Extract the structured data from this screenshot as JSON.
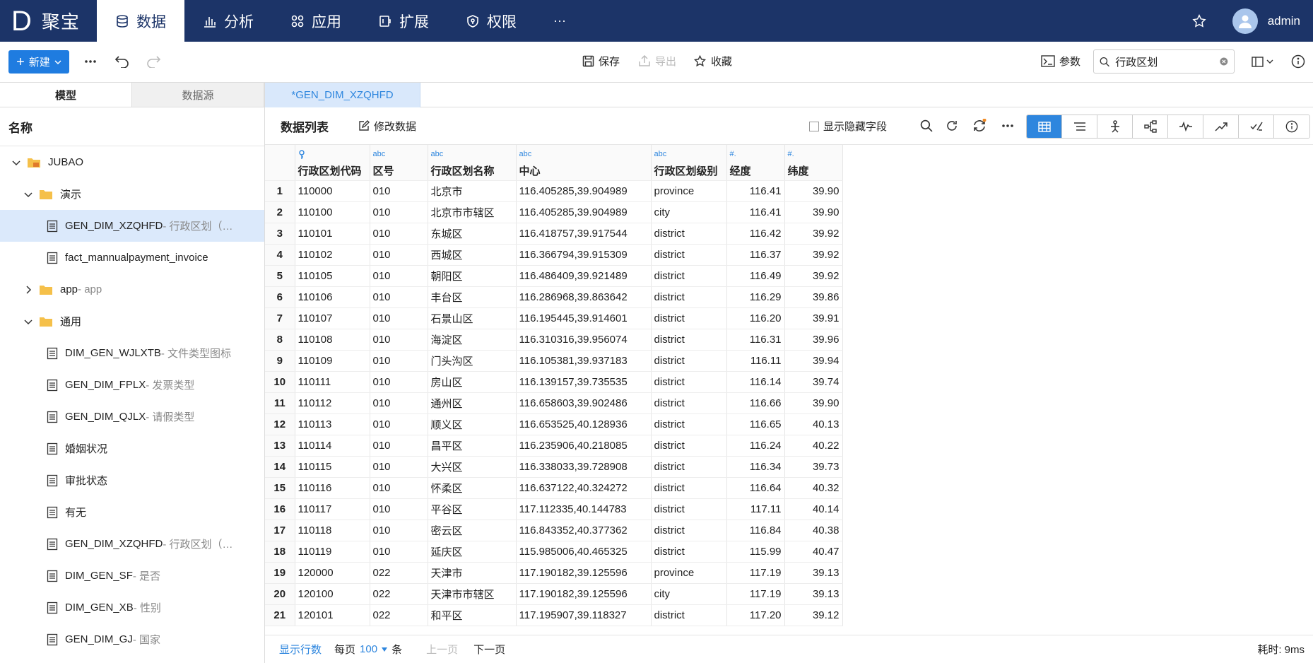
{
  "app": {
    "logo_letter": "D",
    "name": "聚宝",
    "user": "admin"
  },
  "nav": [
    {
      "label": "数据",
      "icon": "database-icon",
      "active": true
    },
    {
      "label": "分析",
      "icon": "bar-chart-icon"
    },
    {
      "label": "应用",
      "icon": "apps-icon"
    },
    {
      "label": "扩展",
      "icon": "extension-icon"
    },
    {
      "label": "权限",
      "icon": "shield-icon"
    }
  ],
  "nav_more": "···",
  "toolbar": {
    "new_label": "新建",
    "save_label": "保存",
    "export_label": "导出",
    "favorite_label": "收藏",
    "params_label": "参数",
    "search_value": "行政区划"
  },
  "left": {
    "tab_model": "模型",
    "tab_datasource": "数据源",
    "header": "名称",
    "tree": [
      {
        "level": 0,
        "type": "root",
        "label": "JUBAO",
        "suffix": "",
        "expanded": true
      },
      {
        "level": 1,
        "type": "folder",
        "label": "演示",
        "suffix": "",
        "expanded": true
      },
      {
        "level": 2,
        "type": "table",
        "label": "GEN_DIM_XZQHFD",
        "suffix": " - 行政区划（…",
        "selected": true
      },
      {
        "level": 2,
        "type": "table",
        "label": "fact_mannualpayment_invoice",
        "suffix": ""
      },
      {
        "level": 1,
        "type": "folder",
        "label": "app",
        "suffix": " - app",
        "expanded": false
      },
      {
        "level": 1,
        "type": "folder",
        "label": "通用",
        "suffix": "",
        "expanded": true
      },
      {
        "level": 2,
        "type": "table",
        "label": "DIM_GEN_WJLXTB",
        "suffix": " - 文件类型图标"
      },
      {
        "level": 2,
        "type": "table",
        "label": "GEN_DIM_FPLX",
        "suffix": " - 发票类型"
      },
      {
        "level": 2,
        "type": "table",
        "label": "GEN_DIM_QJLX",
        "suffix": " - 请假类型"
      },
      {
        "level": 2,
        "type": "table",
        "label": "婚姻状况",
        "suffix": ""
      },
      {
        "level": 2,
        "type": "table",
        "label": "审批状态",
        "suffix": ""
      },
      {
        "level": 2,
        "type": "table",
        "label": "有无",
        "suffix": ""
      },
      {
        "level": 2,
        "type": "table",
        "label": "GEN_DIM_XZQHFD",
        "suffix": " - 行政区划（…"
      },
      {
        "level": 2,
        "type": "table",
        "label": "DIM_GEN_SF",
        "suffix": " - 是否"
      },
      {
        "level": 2,
        "type": "table",
        "label": "DIM_GEN_XB",
        "suffix": " - 性别"
      },
      {
        "level": 2,
        "type": "table",
        "label": "GEN_DIM_GJ",
        "suffix": " - 国家"
      }
    ]
  },
  "right": {
    "doc_tab": "*GEN_DIM_XZQHFD",
    "list_title": "数据列表",
    "edit_label": "修改数据",
    "show_hidden_label": "显示隐藏字段"
  },
  "grid": {
    "columns": [
      {
        "name": "行政区划代码",
        "type": "key"
      },
      {
        "name": "区号",
        "type": "abc"
      },
      {
        "name": "行政区划名称",
        "type": "abc"
      },
      {
        "name": "中心",
        "type": "abc"
      },
      {
        "name": "行政区划级别",
        "type": "abc"
      },
      {
        "name": "经度",
        "type": "#."
      },
      {
        "name": "纬度",
        "type": "#."
      }
    ],
    "rows": [
      [
        "1",
        "110000",
        "010",
        "北京市",
        "116.405285,39.904989",
        "province",
        "116.41",
        "39.90"
      ],
      [
        "2",
        "110100",
        "010",
        "北京市市辖区",
        "116.405285,39.904989",
        "city",
        "116.41",
        "39.90"
      ],
      [
        "3",
        "110101",
        "010",
        "东城区",
        "116.418757,39.917544",
        "district",
        "116.42",
        "39.92"
      ],
      [
        "4",
        "110102",
        "010",
        "西城区",
        "116.366794,39.915309",
        "district",
        "116.37",
        "39.92"
      ],
      [
        "5",
        "110105",
        "010",
        "朝阳区",
        "116.486409,39.921489",
        "district",
        "116.49",
        "39.92"
      ],
      [
        "6",
        "110106",
        "010",
        "丰台区",
        "116.286968,39.863642",
        "district",
        "116.29",
        "39.86"
      ],
      [
        "7",
        "110107",
        "010",
        "石景山区",
        "116.195445,39.914601",
        "district",
        "116.20",
        "39.91"
      ],
      [
        "8",
        "110108",
        "010",
        "海淀区",
        "116.310316,39.956074",
        "district",
        "116.31",
        "39.96"
      ],
      [
        "9",
        "110109",
        "010",
        "门头沟区",
        "116.105381,39.937183",
        "district",
        "116.11",
        "39.94"
      ],
      [
        "10",
        "110111",
        "010",
        "房山区",
        "116.139157,39.735535",
        "district",
        "116.14",
        "39.74"
      ],
      [
        "11",
        "110112",
        "010",
        "通州区",
        "116.658603,39.902486",
        "district",
        "116.66",
        "39.90"
      ],
      [
        "12",
        "110113",
        "010",
        "顺义区",
        "116.653525,40.128936",
        "district",
        "116.65",
        "40.13"
      ],
      [
        "13",
        "110114",
        "010",
        "昌平区",
        "116.235906,40.218085",
        "district",
        "116.24",
        "40.22"
      ],
      [
        "14",
        "110115",
        "010",
        "大兴区",
        "116.338033,39.728908",
        "district",
        "116.34",
        "39.73"
      ],
      [
        "15",
        "110116",
        "010",
        "怀柔区",
        "116.637122,40.324272",
        "district",
        "116.64",
        "40.32"
      ],
      [
        "16",
        "110117",
        "010",
        "平谷区",
        "117.112335,40.144783",
        "district",
        "117.11",
        "40.14"
      ],
      [
        "17",
        "110118",
        "010",
        "密云区",
        "116.843352,40.377362",
        "district",
        "116.84",
        "40.38"
      ],
      [
        "18",
        "110119",
        "010",
        "延庆区",
        "115.985006,40.465325",
        "district",
        "115.99",
        "40.47"
      ],
      [
        "19",
        "120000",
        "022",
        "天津市",
        "117.190182,39.125596",
        "province",
        "117.19",
        "39.13"
      ],
      [
        "20",
        "120100",
        "022",
        "天津市市辖区",
        "117.190182,39.125596",
        "city",
        "117.19",
        "39.13"
      ],
      [
        "21",
        "120101",
        "022",
        "和平区",
        "117.195907,39.118327",
        "district",
        "117.20",
        "39.12"
      ]
    ]
  },
  "footer": {
    "show_rows": "显示行数",
    "per_page": "每页",
    "per_page_value": "100",
    "unit": "条",
    "prev": "上一页",
    "next": "下一页",
    "elapsed": "耗时: 9ms"
  }
}
